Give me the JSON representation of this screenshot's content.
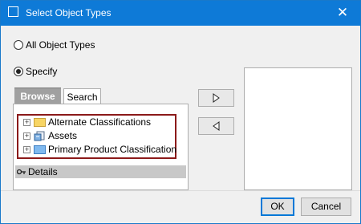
{
  "window": {
    "title": "Select Object Types",
    "close_glyph": "✕"
  },
  "radios": {
    "all": {
      "label": "All Object Types",
      "checked": false
    },
    "specify": {
      "label": "Specify",
      "checked": true
    }
  },
  "tabs": [
    {
      "label": "Browse",
      "active": true
    },
    {
      "label": "Search",
      "active": false
    }
  ],
  "tree": [
    {
      "label": "Alternate Classifications",
      "icon": "folder-yellow-icon",
      "expander": "+"
    },
    {
      "label": "Assets",
      "icon": "assets-icon",
      "expander": "+"
    },
    {
      "label": "Primary Product Classification",
      "icon": "folder-blue-icon",
      "expander": "+"
    }
  ],
  "details": {
    "label": "Details"
  },
  "buttons": {
    "ok": "OK",
    "cancel": "Cancel"
  },
  "colors": {
    "titlebar": "#0e7ad7",
    "highlight_border": "#8b1a1a",
    "tab_active_bg": "#a0a0a0"
  }
}
